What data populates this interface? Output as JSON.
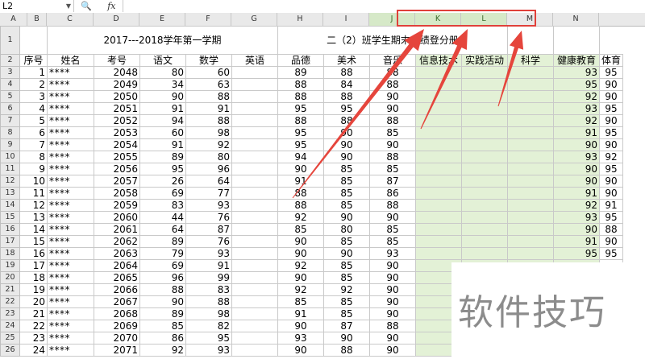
{
  "formula_bar": {
    "name_box": "L2",
    "fx_label": "fx",
    "formula_value": ""
  },
  "columns": [
    "A",
    "B",
    "C",
    "D",
    "E",
    "F",
    "G",
    "H",
    "I",
    "J",
    "K",
    "L",
    "M",
    "N"
  ],
  "selected_columns": [
    "J",
    "K",
    "L"
  ],
  "title_row": {
    "row_number": "1",
    "text_left": "2017---2018学年第一学期",
    "text_right": "二（2）班学生期末成绩登分册"
  },
  "header_row": {
    "row_number": "2",
    "labels": [
      "序号",
      "姓名",
      "考号",
      "语文",
      "数学",
      "英语",
      "品德",
      "美术",
      "音乐",
      "信息技术",
      "实践活动",
      "科学",
      "健康教育",
      "体育"
    ]
  },
  "rows": [
    {
      "rownum": "3",
      "seq": "1",
      "name": "****",
      "id": "2048",
      "chinese": "80",
      "math": "60",
      "english": "",
      "moral": "89",
      "art": "88",
      "music": "88",
      "health": "93",
      "pe": "95"
    },
    {
      "rownum": "4",
      "seq": "2",
      "name": "****",
      "id": "2049",
      "chinese": "34",
      "math": "63",
      "english": "",
      "moral": "88",
      "art": "84",
      "music": "88",
      "health": "95",
      "pe": "90"
    },
    {
      "rownum": "5",
      "seq": "3",
      "name": "****",
      "id": "2050",
      "chinese": "90",
      "math": "88",
      "english": "",
      "moral": "88",
      "art": "88",
      "music": "90",
      "health": "92",
      "pe": "90"
    },
    {
      "rownum": "6",
      "seq": "4",
      "name": "****",
      "id": "2051",
      "chinese": "91",
      "math": "91",
      "english": "",
      "moral": "95",
      "art": "95",
      "music": "90",
      "health": "93",
      "pe": "95"
    },
    {
      "rownum": "7",
      "seq": "5",
      "name": "****",
      "id": "2052",
      "chinese": "94",
      "math": "88",
      "english": "",
      "moral": "88",
      "art": "88",
      "music": "88",
      "health": "92",
      "pe": "90"
    },
    {
      "rownum": "8",
      "seq": "6",
      "name": "****",
      "id": "2053",
      "chinese": "60",
      "math": "98",
      "english": "",
      "moral": "95",
      "art": "90",
      "music": "85",
      "health": "91",
      "pe": "95"
    },
    {
      "rownum": "9",
      "seq": "7",
      "name": "****",
      "id": "2054",
      "chinese": "91",
      "math": "92",
      "english": "",
      "moral": "95",
      "art": "90",
      "music": "90",
      "health": "90",
      "pe": "90"
    },
    {
      "rownum": "10",
      "seq": "8",
      "name": "****",
      "id": "2055",
      "chinese": "89",
      "math": "80",
      "english": "",
      "moral": "94",
      "art": "90",
      "music": "88",
      "health": "93",
      "pe": "92"
    },
    {
      "rownum": "11",
      "seq": "9",
      "name": "****",
      "id": "2056",
      "chinese": "95",
      "math": "96",
      "english": "",
      "moral": "90",
      "art": "85",
      "music": "85",
      "health": "90",
      "pe": "95"
    },
    {
      "rownum": "12",
      "seq": "10",
      "name": "****",
      "id": "2057",
      "chinese": "26",
      "math": "64",
      "english": "",
      "moral": "91",
      "art": "85",
      "music": "87",
      "health": "90",
      "pe": "90"
    },
    {
      "rownum": "13",
      "seq": "11",
      "name": "****",
      "id": "2058",
      "chinese": "69",
      "math": "77",
      "english": "",
      "moral": "88",
      "art": "85",
      "music": "86",
      "health": "91",
      "pe": "90"
    },
    {
      "rownum": "14",
      "seq": "12",
      "name": "****",
      "id": "2059",
      "chinese": "83",
      "math": "93",
      "english": "",
      "moral": "88",
      "art": "85",
      "music": "88",
      "health": "92",
      "pe": "91"
    },
    {
      "rownum": "15",
      "seq": "13",
      "name": "****",
      "id": "2060",
      "chinese": "44",
      "math": "76",
      "english": "",
      "moral": "92",
      "art": "90",
      "music": "90",
      "health": "93",
      "pe": "95"
    },
    {
      "rownum": "16",
      "seq": "14",
      "name": "****",
      "id": "2061",
      "chinese": "64",
      "math": "87",
      "english": "",
      "moral": "85",
      "art": "80",
      "music": "85",
      "health": "90",
      "pe": "88"
    },
    {
      "rownum": "17",
      "seq": "15",
      "name": "****",
      "id": "2062",
      "chinese": "89",
      "math": "76",
      "english": "",
      "moral": "90",
      "art": "85",
      "music": "85",
      "health": "91",
      "pe": "90"
    },
    {
      "rownum": "18",
      "seq": "16",
      "name": "****",
      "id": "2063",
      "chinese": "79",
      "math": "93",
      "english": "",
      "moral": "90",
      "art": "90",
      "music": "93",
      "health": "95",
      "pe": "95"
    },
    {
      "rownum": "19",
      "seq": "17",
      "name": "****",
      "id": "2064",
      "chinese": "69",
      "math": "91",
      "english": "",
      "moral": "92",
      "art": "85",
      "music": "90",
      "health": "",
      "pe": ""
    },
    {
      "rownum": "20",
      "seq": "18",
      "name": "****",
      "id": "2065",
      "chinese": "96",
      "math": "99",
      "english": "",
      "moral": "90",
      "art": "85",
      "music": "90",
      "health": "",
      "pe": ""
    },
    {
      "rownum": "21",
      "seq": "19",
      "name": "****",
      "id": "2066",
      "chinese": "88",
      "math": "83",
      "english": "",
      "moral": "92",
      "art": "92",
      "music": "90",
      "health": "",
      "pe": ""
    },
    {
      "rownum": "22",
      "seq": "20",
      "name": "****",
      "id": "2067",
      "chinese": "90",
      "math": "88",
      "english": "",
      "moral": "85",
      "art": "85",
      "music": "90",
      "health": "",
      "pe": ""
    },
    {
      "rownum": "23",
      "seq": "21",
      "name": "****",
      "id": "2068",
      "chinese": "89",
      "math": "98",
      "english": "",
      "moral": "91",
      "art": "85",
      "music": "90",
      "health": "",
      "pe": ""
    },
    {
      "rownum": "24",
      "seq": "22",
      "name": "****",
      "id": "2069",
      "chinese": "85",
      "math": "82",
      "english": "",
      "moral": "90",
      "art": "87",
      "music": "88",
      "health": "",
      "pe": ""
    },
    {
      "rownum": "25",
      "seq": "23",
      "name": "****",
      "id": "2070",
      "chinese": "86",
      "math": "95",
      "english": "",
      "moral": "93",
      "art": "90",
      "music": "90",
      "health": "",
      "pe": ""
    },
    {
      "rownum": "26",
      "seq": "24",
      "name": "****",
      "id": "2071",
      "chinese": "92",
      "math": "93",
      "english": "",
      "moral": "90",
      "art": "88",
      "music": "90",
      "health": "",
      "pe": ""
    }
  ],
  "watermark": "软件技巧",
  "colors": {
    "accent_red": "#e0403a",
    "selection_green": "#e3f1d6",
    "header_gray": "#e9e9e9"
  }
}
